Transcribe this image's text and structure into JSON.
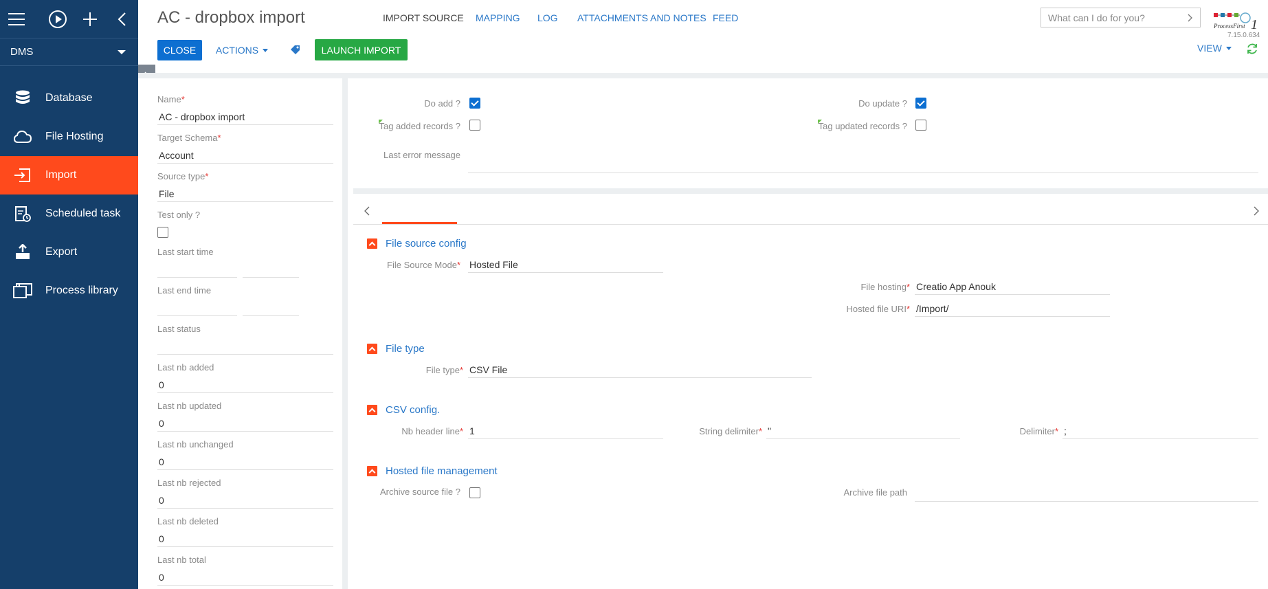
{
  "sidebar": {
    "workplace": "DMS",
    "items": [
      {
        "label": "Database",
        "icon": "database-icon"
      },
      {
        "label": "File Hosting",
        "icon": "cloud-icon"
      },
      {
        "label": "Import",
        "icon": "import-icon",
        "active": true
      },
      {
        "label": "Scheduled task",
        "icon": "scheduled-task-icon"
      },
      {
        "label": "Export",
        "icon": "export-icon"
      },
      {
        "label": "Process library",
        "icon": "process-library-icon"
      }
    ]
  },
  "header": {
    "title": "AC - dropbox import",
    "close_label": "CLOSE",
    "actions_label": "ACTIONS",
    "launch_label": "LAUNCH IMPORT",
    "search_placeholder": "What can I do for you?",
    "version": "7.15.0.634",
    "view_label": "VIEW"
  },
  "left": {
    "name_label": "Name",
    "name_value": "AC - dropbox import",
    "schema_label": "Target Schema",
    "schema_value": "Account",
    "source_type_label": "Source type",
    "source_type_value": "File",
    "test_only_label": "Test only ?",
    "last_start_label": "Last start time",
    "last_end_label": "Last end time",
    "last_status_label": "Last status",
    "last_added_label": "Last nb added",
    "last_added_value": "0",
    "last_updated_label": "Last nb updated",
    "last_updated_value": "0",
    "last_unchanged_label": "Last nb unchanged",
    "last_unchanged_value": "0",
    "last_rejected_label": "Last nb rejected",
    "last_rejected_value": "0",
    "last_deleted_label": "Last nb deleted",
    "last_deleted_value": "0",
    "last_total_label": "Last nb total",
    "last_total_value": "0"
  },
  "top_card": {
    "do_add_label": "Do add ?",
    "do_add_checked": true,
    "do_update_label": "Do update ?",
    "do_update_checked": true,
    "tag_added_label": "Tag added records ?",
    "tag_updated_label": "Tag updated records ?",
    "last_error_label": "Last error message"
  },
  "tabs": [
    "IMPORT SOURCE",
    "MAPPING",
    "LOG",
    "ATTACHMENTS AND NOTES",
    "FEED"
  ],
  "sections": {
    "file_source": {
      "title": "File source config",
      "mode_label": "File Source Mode",
      "mode_value": "Hosted File",
      "hosting_label": "File hosting",
      "hosting_value": "Creatio App Anouk",
      "uri_label": "Hosted file URI",
      "uri_value": "/Import/"
    },
    "file_type": {
      "title": "File type",
      "type_label": "File type",
      "type_value": "CSV File"
    },
    "csv": {
      "title": "CSV config.",
      "header_label": "Nb header line",
      "header_value": "1",
      "string_delim_label": "String delimiter",
      "string_delim_value": "\"",
      "delim_label": "Delimiter",
      "delim_value": ";"
    },
    "hosted": {
      "title": "Hosted file management",
      "archive_label": "Archive source file ?",
      "archive_path_label": "Archive file path"
    }
  },
  "colors": {
    "sidebar": "#153f6a",
    "active": "#ff4a1c",
    "primary": "#0d6fd1",
    "success": "#27a844",
    "link": "#2a78c8"
  }
}
